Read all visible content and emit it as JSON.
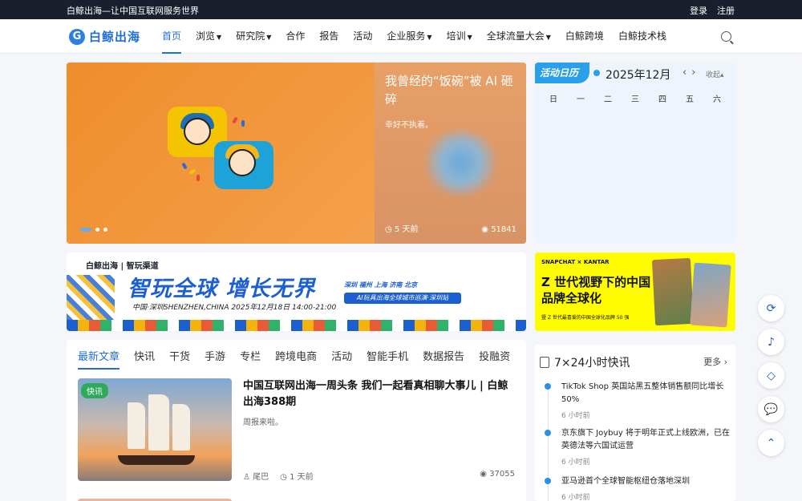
{
  "topbar": {
    "slogan": "白鲸出海—让中国互联网服务世界",
    "login": "登录",
    "register": "注册"
  },
  "nav": {
    "logo_text": "白鲸出海",
    "items": [
      {
        "label": "首页",
        "active": true,
        "dropdown": false
      },
      {
        "label": "浏览",
        "active": false,
        "dropdown": true
      },
      {
        "label": "研究院",
        "active": false,
        "dropdown": true
      },
      {
        "label": "合作",
        "active": false,
        "dropdown": false
      },
      {
        "label": "报告",
        "active": false,
        "dropdown": false
      },
      {
        "label": "活动",
        "active": false,
        "dropdown": false
      },
      {
        "label": "企业服务",
        "active": false,
        "dropdown": true
      },
      {
        "label": "培训",
        "active": false,
        "dropdown": true
      },
      {
        "label": "全球流量大会",
        "active": false,
        "dropdown": true
      },
      {
        "label": "白鲸跨境",
        "active": false,
        "dropdown": false
      },
      {
        "label": "白鲸技术栈",
        "active": false,
        "dropdown": false
      }
    ]
  },
  "hero": {
    "title": "我曾经的“饭碗”被 AI 砸碎",
    "subtitle": "幸好不执着。",
    "time": "5 天前",
    "views": "51841"
  },
  "calendar": {
    "badge": "活动日历",
    "month": "2025年12月",
    "collapse": "收起",
    "weekdays": [
      "日",
      "一",
      "二",
      "三",
      "四",
      "五",
      "六"
    ]
  },
  "banner": {
    "logo": "白鲸出海 | 智玩渠道",
    "headline": "智玩全球 增长无界",
    "subline": "中国·深圳SHENZHEN,CHINA  2025年12月18日 14:00-21:00",
    "cities": "深圳  福州  上海  济南  北京",
    "tag": "AI玩具出海全球城市巡演·深圳站"
  },
  "snap_banner": {
    "brands": "SNAPCHAT  ×  KANTAR",
    "headline": "Z 世代视野下的中国品牌全球化",
    "footer": "暨 Z 世代最喜爱的中国全球化品牌 50 强"
  },
  "tabs": [
    "最新文章",
    "快讯",
    "干货",
    "手游",
    "专栏",
    "跨境电商",
    "活动",
    "智能手机",
    "数据报告",
    "投融资"
  ],
  "article": {
    "label": "快讯",
    "title": "中国互联网出海一周头条 我们一起看真相聊大事儿 | 白鲸出海388期",
    "desc": "周报来啦。",
    "author": "尾巴",
    "time": "1 天前",
    "views": "37055"
  },
  "news": {
    "title": "7×24小时快讯",
    "more": "更多",
    "items": [
      {
        "text": "TikTok Shop 英国站黑五整体销售额同比增长50%",
        "time": "6 小时前"
      },
      {
        "text": "京东旗下 Joybuy 将于明年正式上线欧洲，已在英德法等六国试运营",
        "time": "6 小时前"
      },
      {
        "text": "亚马逊首个全球智能枢纽仓落地深圳",
        "time": "6 小时前"
      }
    ]
  },
  "colors": {
    "brand": "#1f6fd6",
    "hero_orange": "#ef8d2c",
    "snap_yellow": "#fffc00"
  }
}
